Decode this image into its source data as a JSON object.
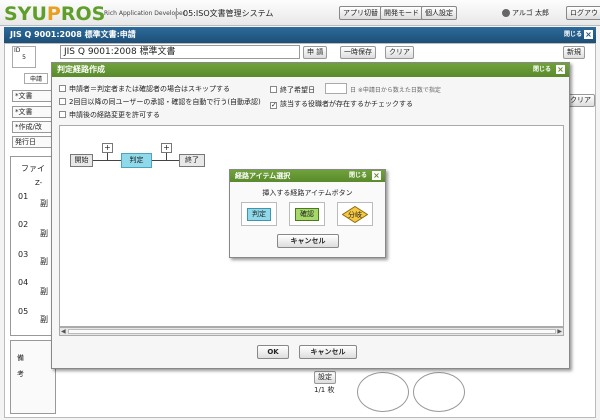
{
  "header": {
    "logo": "SYUPROS",
    "subtitle": "Rich Application Developer",
    "system_name": "05:ISO文書管理システム",
    "buttons": [
      "アプリ切替",
      "開発モード",
      "個人設定"
    ],
    "user": "アルゴ 太郎",
    "logout": "ログアウ"
  },
  "window": {
    "title": "JIS Q 9001:2008 標準文書:申請",
    "close_label": "閉じる",
    "id_label": "ID",
    "id_value": "5",
    "document_title": "JIS Q 9001:2008 標準文書",
    "top_buttons": [
      "申 請",
      "一時保存",
      "クリア"
    ],
    "new_button": "新規",
    "apply_tab": "申請",
    "side_items": [
      "*文書",
      "*文書",
      "*作成/改",
      "発行日"
    ],
    "right_button": "クリア",
    "file_label": "ファイ",
    "file_header": "Z-",
    "rows": [
      "01",
      "02",
      "03",
      "04",
      "05"
    ],
    "row_text": "副",
    "notes_label": [
      "備",
      "考"
    ],
    "settings_button": "設定",
    "pager": "1/1 枚"
  },
  "route_dialog": {
    "title": "判定経路作成",
    "close_label": "閉じる",
    "options": [
      {
        "label": "申請者＝判定者または確認者の場合はスキップする",
        "checked": false
      },
      {
        "label": "2回目以降の同ユーザーの承認・確認を自動で行う(自動承認)",
        "checked": false
      },
      {
        "label": "申請後の経路変更を許可する",
        "checked": false
      }
    ],
    "due_label": "終了希望日",
    "due_hint": "日 ※申請日から数えた日数で指定",
    "check_role": {
      "label": "該当する役職者が存在するかチェックする",
      "checked": true
    },
    "flow": {
      "start": "開始",
      "judge": "判定",
      "end": "終了",
      "plus": "+"
    },
    "ok": "OK",
    "cancel": "キャンセル"
  },
  "item_dialog": {
    "title": "経路アイテム選択",
    "close_label": "閉じる",
    "prompt": "挿入する経路アイテムボタン",
    "items": [
      "判定",
      "確認",
      "分岐"
    ],
    "cancel": "キャンセル"
  },
  "colors": {
    "brand_green": "#5f9e2a",
    "title_blue": "#1d4f78",
    "dialog_green": "#5a8a2c",
    "judge_cyan": "#8fd9ea",
    "confirm_green": "#a6d96a",
    "branch_yellow": "#f5c842"
  }
}
